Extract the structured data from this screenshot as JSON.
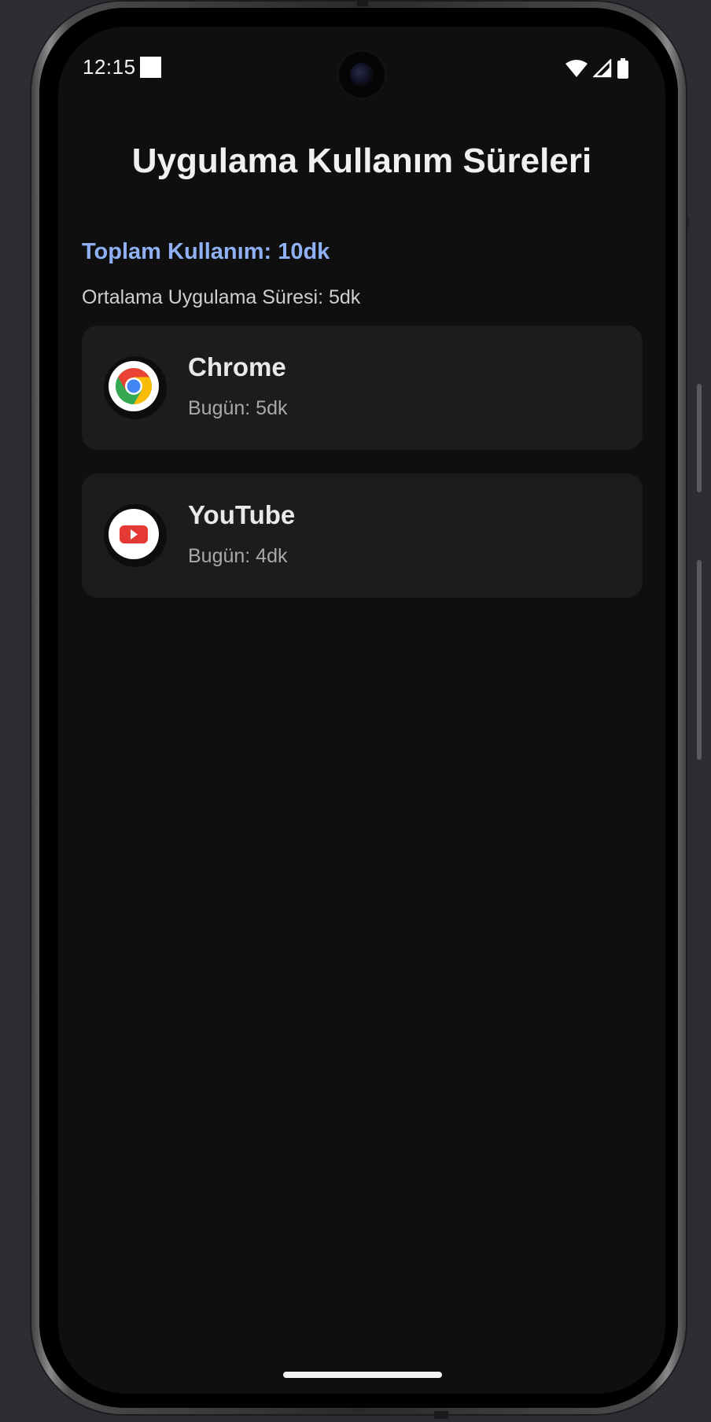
{
  "status_bar": {
    "time": "12:15",
    "icons": [
      "wifi-icon",
      "cell-signal-icon",
      "battery-icon"
    ]
  },
  "main": {
    "title": "Uygulama Kullanım Süreleri",
    "total_usage": "Toplam Kullanım: 10dk",
    "average_usage": "Ortalama Uygulama Süresi: 5dk",
    "apps": [
      {
        "name": "Chrome",
        "usage": "Bugün: 5dk",
        "icon": "chrome-icon"
      },
      {
        "name": "YouTube",
        "usage": "Bugün: 4dk",
        "icon": "youtube-icon"
      }
    ]
  },
  "colors": {
    "screen_background": "#0f0f10",
    "card_background": "#1c1c1d",
    "accent": "#8fb0f2",
    "youtube_red": "#e53935"
  }
}
